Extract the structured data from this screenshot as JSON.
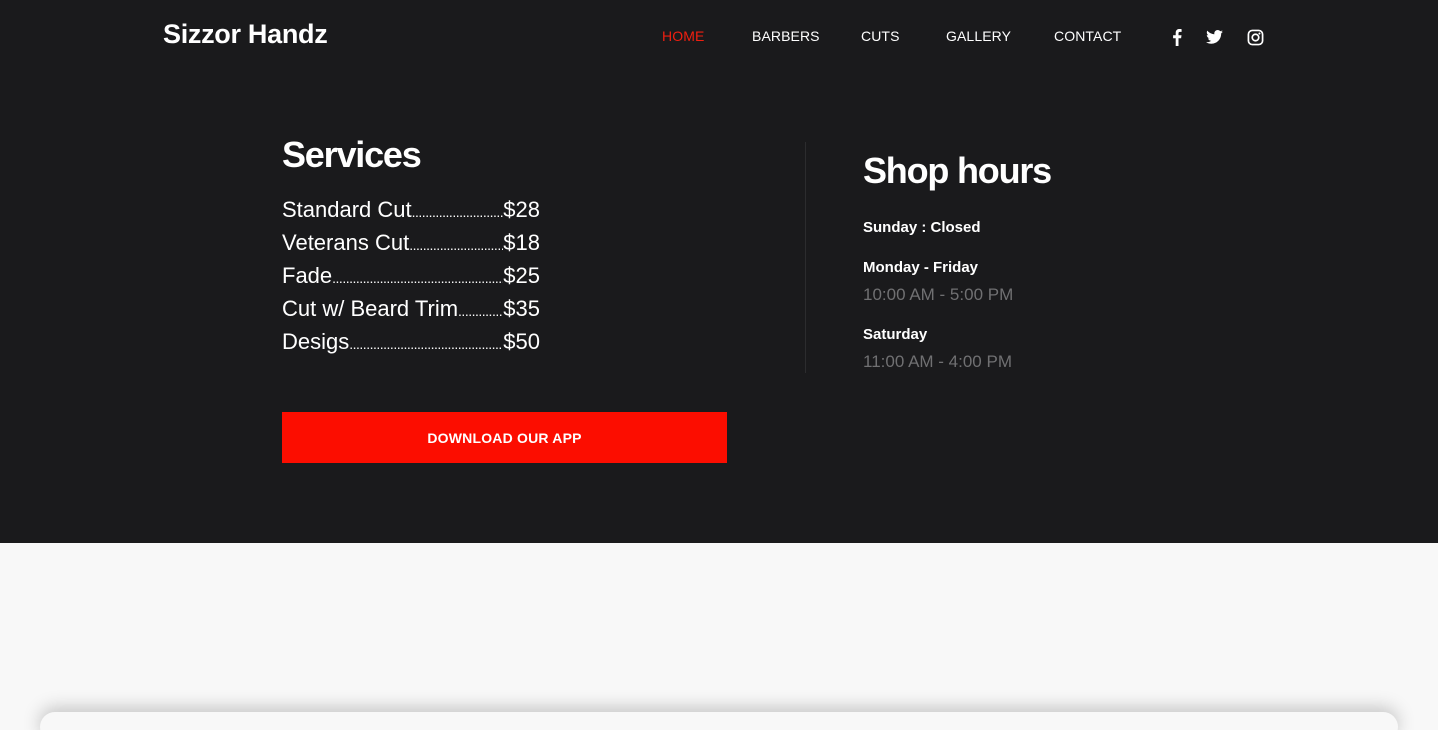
{
  "brand": {
    "name": "Sizzor Handz"
  },
  "nav": {
    "items": [
      {
        "label": "HOME",
        "active": true
      },
      {
        "label": "BARBERS",
        "active": false
      },
      {
        "label": "CUTS",
        "active": false
      },
      {
        "label": "GALLERY",
        "active": false
      },
      {
        "label": "CONTACT",
        "active": false
      }
    ],
    "social": [
      "facebook-icon",
      "twitter-icon",
      "instagram-icon"
    ]
  },
  "services": {
    "title": "Services",
    "items": [
      {
        "name": "Standard Cut",
        "price": "$28"
      },
      {
        "name": "Veterans Cut",
        "price": "$18"
      },
      {
        "name": "Fade",
        "price": "$25"
      },
      {
        "name": "Cut w/ Beard Trim",
        "price": "$35"
      },
      {
        "name": "Desigs",
        "price": "$50"
      }
    ],
    "download_label": "DOWNLOAD OUR APP"
  },
  "hours": {
    "title": "Shop hours",
    "sunday": "Sunday : Closed",
    "weekday_label": "Monday - Friday",
    "weekday_time": "10:00 AM - 5:00 PM",
    "saturday_label": "Saturday",
    "saturday_time": "11:00 AM - 4:00 PM"
  },
  "colors": {
    "background_dark": "#1a1a1c",
    "accent": "#fc0d00",
    "nav_active": "#f01f10",
    "muted_text": "#707072",
    "page_light": "#f8f8f8"
  }
}
